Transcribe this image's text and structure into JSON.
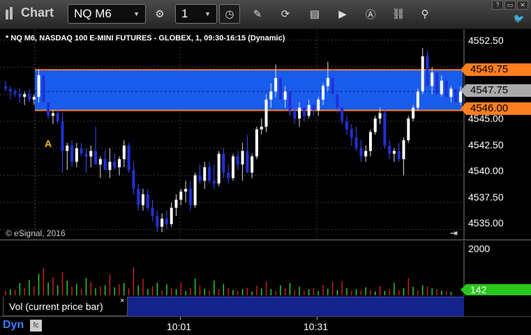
{
  "toolbar": {
    "app_title": "Chart",
    "symbol": "NQ M6",
    "interval": "1",
    "icons": [
      "chart-app-icon",
      "symbol-dropdown-icon",
      "settings-gear-icon",
      "interval-dropdown-icon",
      "clock-icon",
      "pencil-draw-icon",
      "refresh-icon",
      "studies-icon",
      "play-icon",
      "alert-icon",
      "link-icon",
      "pin-icon",
      "help-icon",
      "minimize-icon",
      "maximize-icon",
      "close-icon",
      "twitter-icon"
    ],
    "window_buttons": [
      "?",
      "▭",
      "✕"
    ]
  },
  "chart": {
    "title": "* NQ M6, NASDAQ 100 E-MINI FUTURES - GLOBEX, 1, 09:30-16:15 (Dynamic)",
    "copyright": "© eSignal, 2016",
    "marker": "A",
    "price_ticks": [
      "4552.50",
      "4550.00",
      "4547.50",
      "4545.00",
      "4542.50",
      "4540.00",
      "4537.50",
      "4535.00"
    ],
    "upper_line_flag": "4549.75",
    "last_price_flag": "4547.75",
    "lower_line_flag": "4546.00",
    "volume_axis_label": "2000",
    "volume_last_flag": "142",
    "time_labels": [
      "10:01",
      "10:31"
    ],
    "study_label": "Vol (current price bar)",
    "study_close": "×",
    "footer_label": "Dyn",
    "colors": {
      "range_band": "#1a64ff",
      "range_lines": "#ff7e1f",
      "up_bar": "#ffffff",
      "down_bar": "#1f2fd9",
      "vol_up": "#2bd92b",
      "vol_down": "#d42020",
      "vol_flag": "#28c81a"
    }
  },
  "chart_data": {
    "type": "candlestick",
    "title": "* NQ M6, NASDAQ 100 E-MINI FUTURES - GLOBEX, 1, 09:30-16:15 (Dynamic)",
    "ylim": [
      4534,
      4553.5
    ],
    "range_band": [
      4546.0,
      4549.75
    ],
    "bars": [
      [
        4548.25,
        4548.75,
        4547.75,
        4548.0
      ],
      [
        4548.0,
        4548.25,
        4547.0,
        4547.75
      ],
      [
        4547.75,
        4548.0,
        4547.25,
        4547.5
      ],
      [
        4547.5,
        4548.0,
        4546.75,
        4547.25
      ],
      [
        4547.25,
        4547.75,
        4546.5,
        4547.5
      ],
      [
        4547.5,
        4548.0,
        4546.75,
        4547.0
      ],
      [
        4547.0,
        4547.5,
        4546.5,
        4547.25
      ],
      [
        4547.25,
        4549.75,
        4546.75,
        4549.25
      ],
      [
        4549.25,
        4549.75,
        4546.5,
        4546.75
      ],
      [
        4546.75,
        4547.0,
        4545.25,
        4545.5
      ],
      [
        4545.5,
        4546.0,
        4544.75,
        4545.75
      ],
      [
        4545.75,
        4546.25,
        4544.75,
        4545.0
      ],
      [
        4545.0,
        4545.75,
        4540.25,
        4542.25
      ],
      [
        4542.25,
        4543.0,
        4540.5,
        4542.75
      ],
      [
        4542.75,
        4543.25,
        4540.75,
        4541.25
      ],
      [
        4541.25,
        4543.0,
        4540.75,
        4542.5
      ],
      [
        4542.5,
        4543.0,
        4541.75,
        4542.0
      ],
      [
        4542.0,
        4542.5,
        4540.25,
        4541.75
      ],
      [
        4541.75,
        4542.75,
        4540.75,
        4542.25
      ],
      [
        4542.25,
        4544.5,
        4541.25,
        4541.0
      ],
      [
        4541.0,
        4541.75,
        4539.75,
        4541.5
      ],
      [
        4541.5,
        4542.25,
        4540.75,
        4540.5
      ],
      [
        4540.5,
        4542.5,
        4539.75,
        4541.25
      ],
      [
        4541.25,
        4542.0,
        4540.5,
        4540.75
      ],
      [
        4540.75,
        4541.75,
        4540.0,
        4541.5
      ],
      [
        4541.5,
        4543.25,
        4540.75,
        4542.75
      ],
      [
        4542.75,
        4543.0,
        4540.25,
        4540.5
      ],
      [
        4540.5,
        4541.25,
        4538.25,
        4538.75
      ],
      [
        4538.75,
        4539.25,
        4536.75,
        4537.25
      ],
      [
        4537.25,
        4538.75,
        4536.75,
        4538.25
      ],
      [
        4538.25,
        4538.75,
        4536.75,
        4537.0
      ],
      [
        4537.0,
        4537.75,
        4535.75,
        4536.25
      ],
      [
        4536.25,
        4536.75,
        4534.75,
        4535.25
      ],
      [
        4535.25,
        4536.5,
        4534.75,
        4536.0
      ],
      [
        4536.0,
        4536.75,
        4535.0,
        4535.5
      ],
      [
        4535.5,
        4537.5,
        4535.25,
        4537.0
      ],
      [
        4537.0,
        4538.25,
        4536.25,
        4537.75
      ],
      [
        4537.75,
        4538.75,
        4537.25,
        4538.5
      ],
      [
        4538.5,
        4539.5,
        4537.5,
        4538.75
      ],
      [
        4538.75,
        4539.5,
        4536.75,
        4537.25
      ],
      [
        4537.25,
        4540.25,
        4537.0,
        4540.0
      ],
      [
        4540.0,
        4541.0,
        4539.25,
        4539.5
      ],
      [
        4539.5,
        4541.25,
        4538.75,
        4540.75
      ],
      [
        4540.75,
        4541.25,
        4539.25,
        4539.5
      ],
      [
        4539.5,
        4541.0,
        4538.75,
        4539.25
      ],
      [
        4539.25,
        4542.25,
        4539.0,
        4542.0
      ],
      [
        4542.0,
        4542.5,
        4539.75,
        4540.25
      ],
      [
        4540.25,
        4541.0,
        4539.25,
        4539.75
      ],
      [
        4539.75,
        4542.0,
        4539.5,
        4541.75
      ],
      [
        4541.75,
        4542.25,
        4540.5,
        4541.0
      ],
      [
        4541.0,
        4543.0,
        4539.5,
        4542.25
      ],
      [
        4542.25,
        4543.75,
        4541.25,
        4540.25
      ],
      [
        4540.25,
        4542.0,
        4539.75,
        4541.75
      ],
      [
        4541.75,
        4544.5,
        4541.5,
        4544.25
      ],
      [
        4544.25,
        4545.25,
        4543.75,
        4544.5
      ],
      [
        4544.5,
        4547.5,
        4544.0,
        4547.0
      ],
      [
        4547.0,
        4548.5,
        4546.25,
        4547.75
      ],
      [
        4547.75,
        4550.25,
        4547.25,
        4549.0
      ],
      [
        4549.0,
        4549.5,
        4546.75,
        4547.0
      ],
      [
        4547.0,
        4548.25,
        4546.25,
        4547.75
      ],
      [
        4547.75,
        4548.25,
        4545.5,
        4546.0
      ],
      [
        4546.0,
        4546.75,
        4544.75,
        4545.25
      ],
      [
        4545.25,
        4546.75,
        4544.5,
        4546.25
      ],
      [
        4546.25,
        4546.75,
        4545.0,
        4545.5
      ],
      [
        4545.5,
        4547.0,
        4545.25,
        4546.5
      ],
      [
        4546.5,
        4547.5,
        4545.5,
        4546.0
      ],
      [
        4546.0,
        4547.25,
        4545.5,
        4547.0
      ],
      [
        4547.0,
        4548.5,
        4546.5,
        4548.25
      ],
      [
        4548.25,
        4550.5,
        4547.75,
        4549.0
      ],
      [
        4549.0,
        4549.75,
        4547.25,
        4547.5
      ],
      [
        4547.5,
        4548.0,
        4545.75,
        4546.25
      ],
      [
        4546.25,
        4546.75,
        4544.75,
        4545.0
      ],
      [
        4545.0,
        4545.5,
        4543.75,
        4544.25
      ],
      [
        4544.25,
        4544.75,
        4542.75,
        4543.5
      ],
      [
        4543.5,
        4544.5,
        4542.25,
        4542.5
      ],
      [
        4542.5,
        4543.25,
        4541.25,
        4541.75
      ],
      [
        4541.75,
        4542.75,
        4541.25,
        4542.25
      ],
      [
        4542.25,
        4544.25,
        4541.75,
        4544.0
      ],
      [
        4544.0,
        4545.5,
        4543.75,
        4545.25
      ],
      [
        4545.25,
        4546.25,
        4544.75,
        4545.75
      ],
      [
        4545.75,
        4546.25,
        4542.5,
        4542.75
      ],
      [
        4542.75,
        4543.25,
        4541.5,
        4542.0
      ],
      [
        4542.0,
        4542.5,
        4541.25,
        4542.25
      ],
      [
        4542.25,
        4543.0,
        4541.25,
        4541.5
      ],
      [
        4541.5,
        4543.5,
        4540.0,
        4543.25
      ],
      [
        4543.25,
        4545.5,
        4543.0,
        4545.25
      ],
      [
        4545.25,
        4546.5,
        4545.0,
        4546.25
      ],
      [
        4546.25,
        4548.0,
        4546.0,
        4547.75
      ],
      [
        4547.75,
        4551.75,
        4547.5,
        4551.0
      ],
      [
        4551.0,
        4551.5,
        4548.0,
        4548.25
      ],
      [
        4548.25,
        4550.0,
        4547.5,
        4549.5
      ],
      [
        4549.5,
        4549.75,
        4547.0,
        4547.5
      ],
      [
        4547.5,
        4549.25,
        4547.25,
        4548.75
      ],
      [
        4548.75,
        4549.25,
        4547.0,
        4547.25
      ],
      [
        4547.25,
        4548.25,
        4546.75,
        4548.0
      ],
      [
        4548.0,
        4548.5,
        4546.5,
        4546.75
      ],
      [
        4546.75,
        4548.25,
        4546.5,
        4547.75
      ]
    ],
    "volume": [
      [
        180,
        "down"
      ],
      [
        260,
        "up"
      ],
      [
        220,
        "down"
      ],
      [
        520,
        "up"
      ],
      [
        300,
        "down"
      ],
      [
        640,
        "up"
      ],
      [
        380,
        "down"
      ],
      [
        900,
        "up"
      ],
      [
        1150,
        "down"
      ],
      [
        540,
        "up"
      ],
      [
        760,
        "down"
      ],
      [
        420,
        "up"
      ],
      [
        980,
        "down"
      ],
      [
        620,
        "up"
      ],
      [
        360,
        "down"
      ],
      [
        480,
        "up"
      ],
      [
        260,
        "down"
      ],
      [
        720,
        "up"
      ],
      [
        560,
        "down"
      ],
      [
        300,
        "up"
      ],
      [
        380,
        "down"
      ],
      [
        420,
        "up"
      ],
      [
        880,
        "down"
      ],
      [
        340,
        "up"
      ],
      [
        460,
        "down"
      ],
      [
        520,
        "up"
      ],
      [
        300,
        "down"
      ],
      [
        1180,
        "down"
      ],
      [
        420,
        "up"
      ],
      [
        700,
        "down"
      ],
      [
        260,
        "up"
      ],
      [
        380,
        "down"
      ],
      [
        520,
        "up"
      ],
      [
        200,
        "down"
      ],
      [
        460,
        "up"
      ],
      [
        320,
        "down"
      ],
      [
        260,
        "up"
      ],
      [
        540,
        "down"
      ],
      [
        180,
        "up"
      ],
      [
        300,
        "down"
      ],
      [
        700,
        "up"
      ],
      [
        400,
        "down"
      ],
      [
        280,
        "up"
      ],
      [
        200,
        "down"
      ],
      [
        620,
        "up"
      ],
      [
        260,
        "down"
      ],
      [
        480,
        "up"
      ],
      [
        300,
        "down"
      ],
      [
        220,
        "up"
      ],
      [
        180,
        "down"
      ],
      [
        260,
        "up"
      ],
      [
        320,
        "down"
      ],
      [
        160,
        "up"
      ],
      [
        400,
        "down"
      ],
      [
        300,
        "up"
      ],
      [
        560,
        "down"
      ],
      [
        260,
        "up"
      ],
      [
        180,
        "down"
      ],
      [
        420,
        "up"
      ],
      [
        300,
        "down"
      ],
      [
        520,
        "up"
      ],
      [
        220,
        "down"
      ],
      [
        360,
        "up"
      ],
      [
        200,
        "down"
      ],
      [
        260,
        "up"
      ],
      [
        300,
        "down"
      ],
      [
        180,
        "up"
      ],
      [
        440,
        "down"
      ],
      [
        280,
        "up"
      ],
      [
        560,
        "down"
      ],
      [
        220,
        "up"
      ],
      [
        600,
        "down"
      ],
      [
        300,
        "up"
      ],
      [
        180,
        "down"
      ],
      [
        260,
        "up"
      ],
      [
        200,
        "down"
      ],
      [
        340,
        "up"
      ],
      [
        220,
        "down"
      ],
      [
        160,
        "up"
      ],
      [
        400,
        "down"
      ],
      [
        180,
        "up"
      ],
      [
        260,
        "down"
      ],
      [
        520,
        "up"
      ],
      [
        220,
        "down"
      ],
      [
        300,
        "up"
      ],
      [
        720,
        "down"
      ],
      [
        360,
        "up"
      ],
      [
        200,
        "down"
      ],
      [
        420,
        "up"
      ],
      [
        380,
        "down"
      ],
      [
        300,
        "up"
      ],
      [
        240,
        "down"
      ],
      [
        200,
        "up"
      ],
      [
        160,
        "down"
      ],
      [
        142,
        "up"
      ]
    ],
    "volume_ylim": [
      0,
      2000
    ],
    "x_time_labels": [
      {
        "label": "10:01",
        "bar": 31
      },
      {
        "label": "10:31",
        "bar": 61
      }
    ]
  }
}
